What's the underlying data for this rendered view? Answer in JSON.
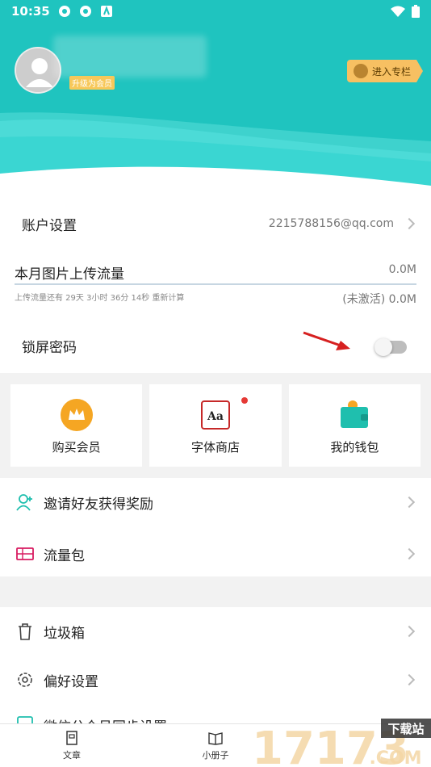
{
  "status_bar": {
    "time": "10:35"
  },
  "header": {
    "vip_badge": "升级为会员",
    "column_button": "进入专栏",
    "bg_color": "#1fc4bf"
  },
  "account": {
    "label": "账户设置",
    "email": "2215788156@qq.com"
  },
  "upload": {
    "title": "本月图片上传流量",
    "used": "0.0M",
    "note": "上传流量还有 29天 3小时 36分 14秒 重新计算",
    "status": "(未激活) 0.0M"
  },
  "lock": {
    "label": "锁屏密码",
    "enabled": false
  },
  "cards": [
    {
      "label": "购买会员",
      "icon": "crown-icon"
    },
    {
      "label": "字体商店",
      "icon": "font-icon",
      "badge": true
    },
    {
      "label": "我的钱包",
      "icon": "wallet-icon"
    }
  ],
  "list1": [
    {
      "label": "邀请好友获得奖励",
      "icon": "invite-user-icon"
    },
    {
      "label": "流量包",
      "icon": "ticket-icon"
    }
  ],
  "list2": [
    {
      "label": "垃圾箱",
      "icon": "trash-icon"
    },
    {
      "label": "偏好设置",
      "icon": "gear-icon"
    },
    {
      "label": "微信公众号同步设置",
      "icon": "wechat-sync-icon"
    }
  ],
  "bottom_nav": [
    {
      "label": "文章",
      "icon": "article-icon"
    },
    {
      "label": "小册子",
      "icon": "booklet-icon"
    }
  ],
  "watermark": {
    "number": "17173",
    "site": "下载站",
    "domain": ".COM"
  }
}
